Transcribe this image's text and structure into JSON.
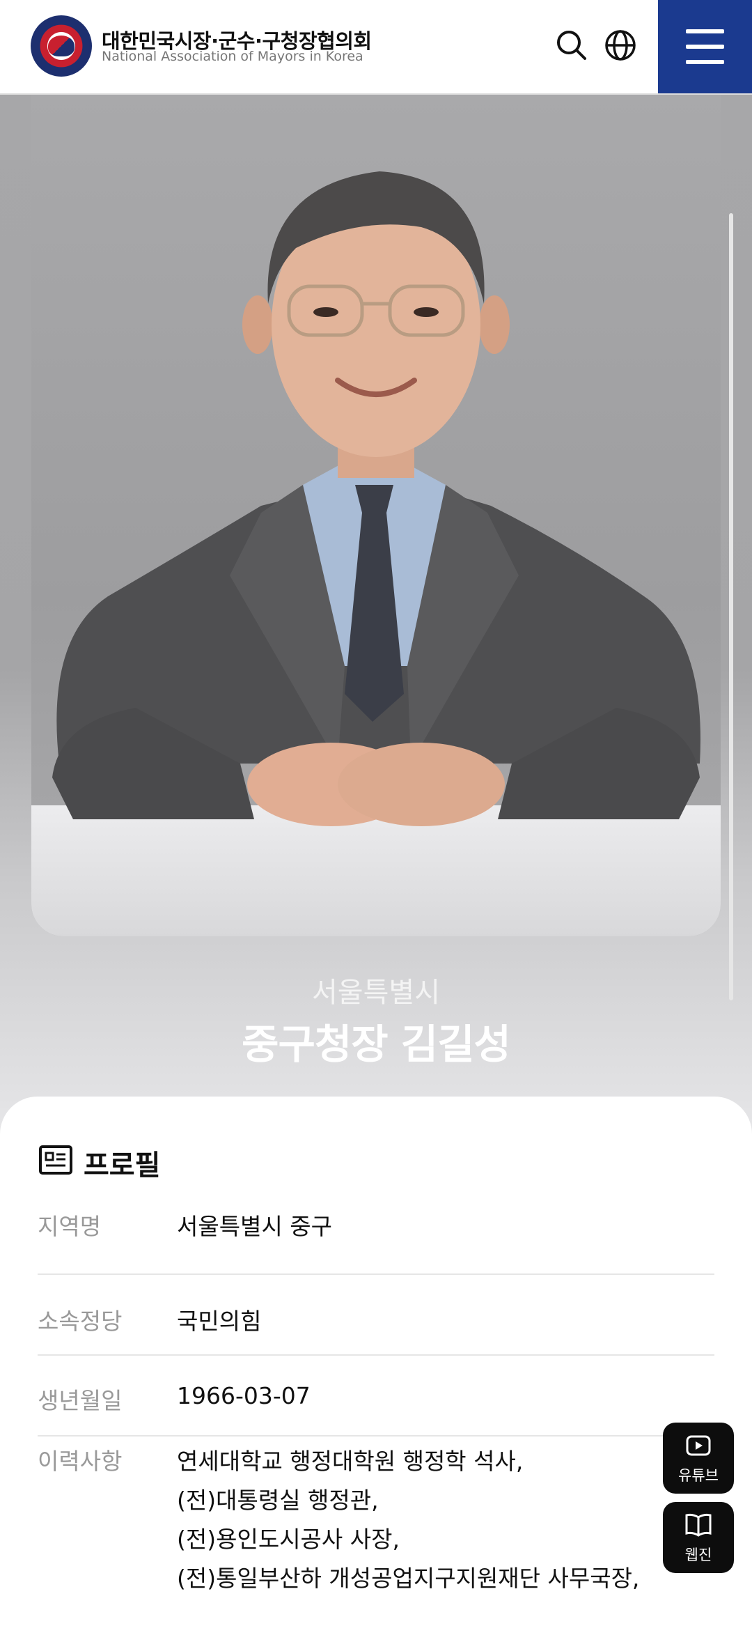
{
  "header": {
    "org_name_ko": "대한민국시장·군수·구청장협의회",
    "org_name_en": "National Association of Mayors in Korea",
    "logo_icon": "association-seal-logo",
    "search_icon": "search-icon",
    "language_icon": "globe-icon",
    "menu_icon": "hamburger-menu-icon",
    "menu_color": "#1b3a8f"
  },
  "hero": {
    "region": "서울특별시",
    "name": "중구청장 김길성"
  },
  "profile": {
    "title": "프로필",
    "icon": "id-card-icon",
    "rows": [
      {
        "label": "지역명",
        "value": "서울특별시 중구"
      },
      {
        "label": "소속정당",
        "value": "국민의힘"
      },
      {
        "label": "생년월일",
        "value": "1966-03-07"
      }
    ],
    "history_label": "이력사항",
    "history": [
      "연세대학교 행정대학원 행정학 석사,",
      "(전)대통령실 행정관,",
      "(전)용인도시공사 사장,",
      "(전)통일부산하 개성공업지구지원재단 사무국장,"
    ]
  },
  "floating": {
    "youtube_label": "유튜브",
    "webzine_label": "웹진"
  }
}
